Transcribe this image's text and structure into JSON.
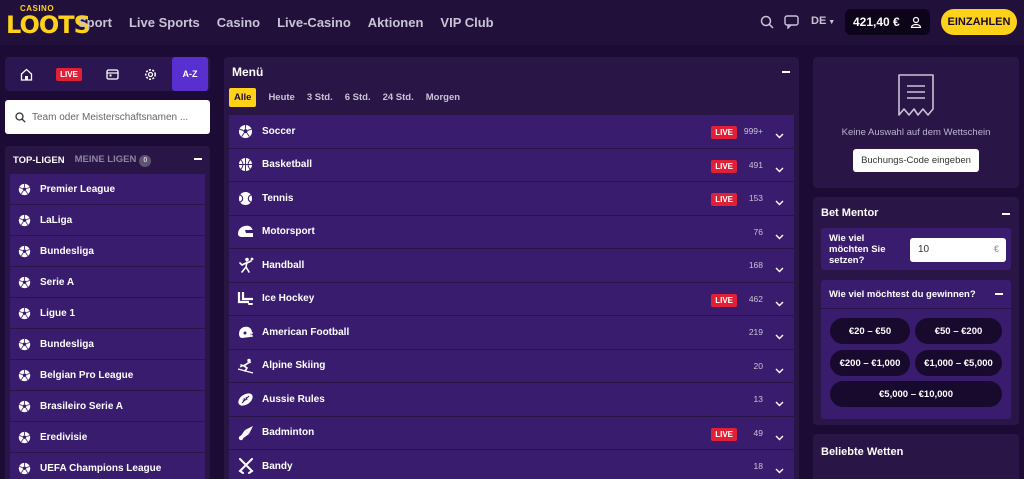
{
  "brand": {
    "logo_top": "CASINO",
    "logo_main": "LOOTS",
    "accent": "#ffd21a"
  },
  "nav": [
    "Sport",
    "Live Sports",
    "Casino",
    "Live-Casino",
    "Aktionen",
    "VIP Club"
  ],
  "header": {
    "lang": "DE",
    "balance": "421,40 €",
    "deposit": "EINZAHLEN"
  },
  "iconbar": {
    "live": "LIVE",
    "az": "A-Z"
  },
  "search": {
    "placeholder": "Team oder Meisterschaftsnamen ..."
  },
  "leagues": {
    "tab_top": "TOP-LIGEN",
    "tab_mine": "MEINE LIGEN",
    "mine_count": "0",
    "items": [
      "Premier League",
      "LaLiga",
      "Bundesliga",
      "Serie A",
      "Ligue 1",
      "Bundesliga",
      "Belgian Pro League",
      "Brasileiro Serie A",
      "Eredivisie",
      "UEFA Champions League"
    ]
  },
  "menu": {
    "title": "Menü",
    "filters": [
      "Alle",
      "Heute",
      "3 Std.",
      "6 Std.",
      "24 Std.",
      "Morgen"
    ],
    "live_label": "LIVE",
    "sports": [
      {
        "name": "Soccer",
        "icon": "soccer-ball-icon",
        "live": true,
        "count": "999+"
      },
      {
        "name": "Basketball",
        "icon": "basketball-icon",
        "live": true,
        "count": "491"
      },
      {
        "name": "Tennis",
        "icon": "tennis-ball-icon",
        "live": true,
        "count": "153"
      },
      {
        "name": "Motorsport",
        "icon": "helmet-icon",
        "live": false,
        "count": "76"
      },
      {
        "name": "Handball",
        "icon": "handball-player-icon",
        "live": false,
        "count": "168"
      },
      {
        "name": "Ice Hockey",
        "icon": "hockey-stick-icon",
        "live": true,
        "count": "462"
      },
      {
        "name": "American Football",
        "icon": "football-helmet-icon",
        "live": false,
        "count": "219"
      },
      {
        "name": "Alpine Skiing",
        "icon": "skier-icon",
        "live": false,
        "count": "20"
      },
      {
        "name": "Aussie Rules",
        "icon": "rugby-ball-icon",
        "live": false,
        "count": "13"
      },
      {
        "name": "Badminton",
        "icon": "shuttlecock-icon",
        "live": true,
        "count": "49"
      },
      {
        "name": "Bandy",
        "icon": "bandy-sticks-icon",
        "live": false,
        "count": "18"
      }
    ]
  },
  "betslip": {
    "empty_text": "Keine Auswahl auf dem Wettschein",
    "code_button": "Buchungs-Code eingeben"
  },
  "mentor": {
    "title": "Bet Mentor",
    "stake_question": "Wie viel möchten Sie setzen?",
    "stake_value": "10",
    "stake_currency": "€",
    "win_question": "Wie viel möchtest du gewinnen?",
    "ranges": [
      "€20 – €50",
      "€50 – €200",
      "€200 – €1,000",
      "€1,000 – €5,000",
      "€5,000 – €10,000"
    ]
  },
  "popular": {
    "title": "Beliebte Wetten"
  }
}
